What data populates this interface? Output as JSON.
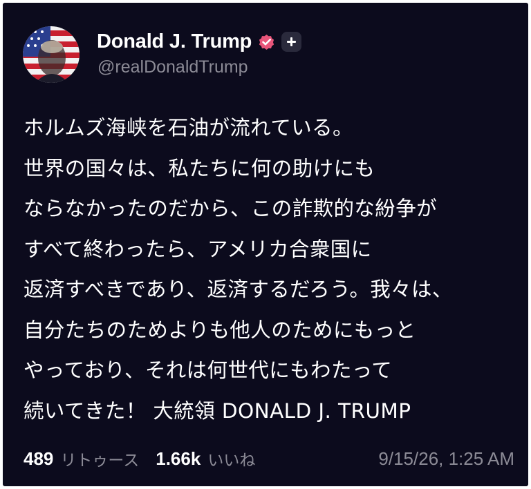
{
  "author": {
    "name": "Donald J. Trump",
    "handle": "@realDonaldTrump",
    "avatar": "avatar-flag-portrait",
    "verified_icon": "verified-badge-icon",
    "subscribe_icon": "plus-icon"
  },
  "post": {
    "lines": [
      "ホルムズ海峡を石油が流れている。",
      "世界の国々は、私たちに何の助けにも",
      "ならなかったのだから、この詐欺的な紛争が",
      "すべて終わったら、アメリカ合衆国に",
      "返済すべきであり、返済するだろう。我々は、",
      "自分たちのためよりも他人のためにもっと",
      "やっており、それは何世代にもわたって",
      "続いてきた！ 大統領 DONALD J. TRUMP"
    ]
  },
  "stats": {
    "reposts_count": "489",
    "reposts_label": "リトゥース",
    "likes_count": "1.66k",
    "likes_label": "いいね",
    "timestamp": "9/15/26, 1:25 AM"
  },
  "colors": {
    "background": "#0c0b1d",
    "text": "#ffffff",
    "muted": "#8c8b96",
    "verified": "#e8557a"
  }
}
